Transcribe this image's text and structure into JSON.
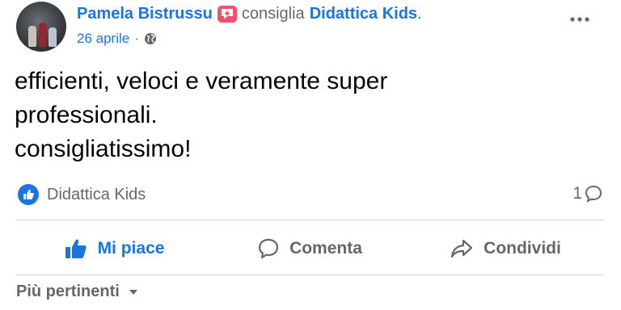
{
  "post": {
    "author": "Pamela Bistrussu",
    "verb": "consiglia",
    "page": "Didattica Kids",
    "page_suffix": ".",
    "date": "26 aprile",
    "date_separator": "·",
    "privacy_icon": "globe-icon",
    "text_lines": [
      "efficienti, veloci e veramente super",
      "professionali.",
      "consigliatissimo!"
    ]
  },
  "reactions": {
    "icon": "like-icon",
    "label": "Didattica Kids",
    "comment_count": "1"
  },
  "actions": {
    "like": "Mi piace",
    "comment": "Comenta",
    "share": "Condividi"
  },
  "sort": {
    "label": "Più pertinenti"
  },
  "colors": {
    "link_blue": "#1b74e4",
    "secondary_text": "#65676b",
    "badge_pink": "#f0506e",
    "divider": "#ced0d4"
  }
}
